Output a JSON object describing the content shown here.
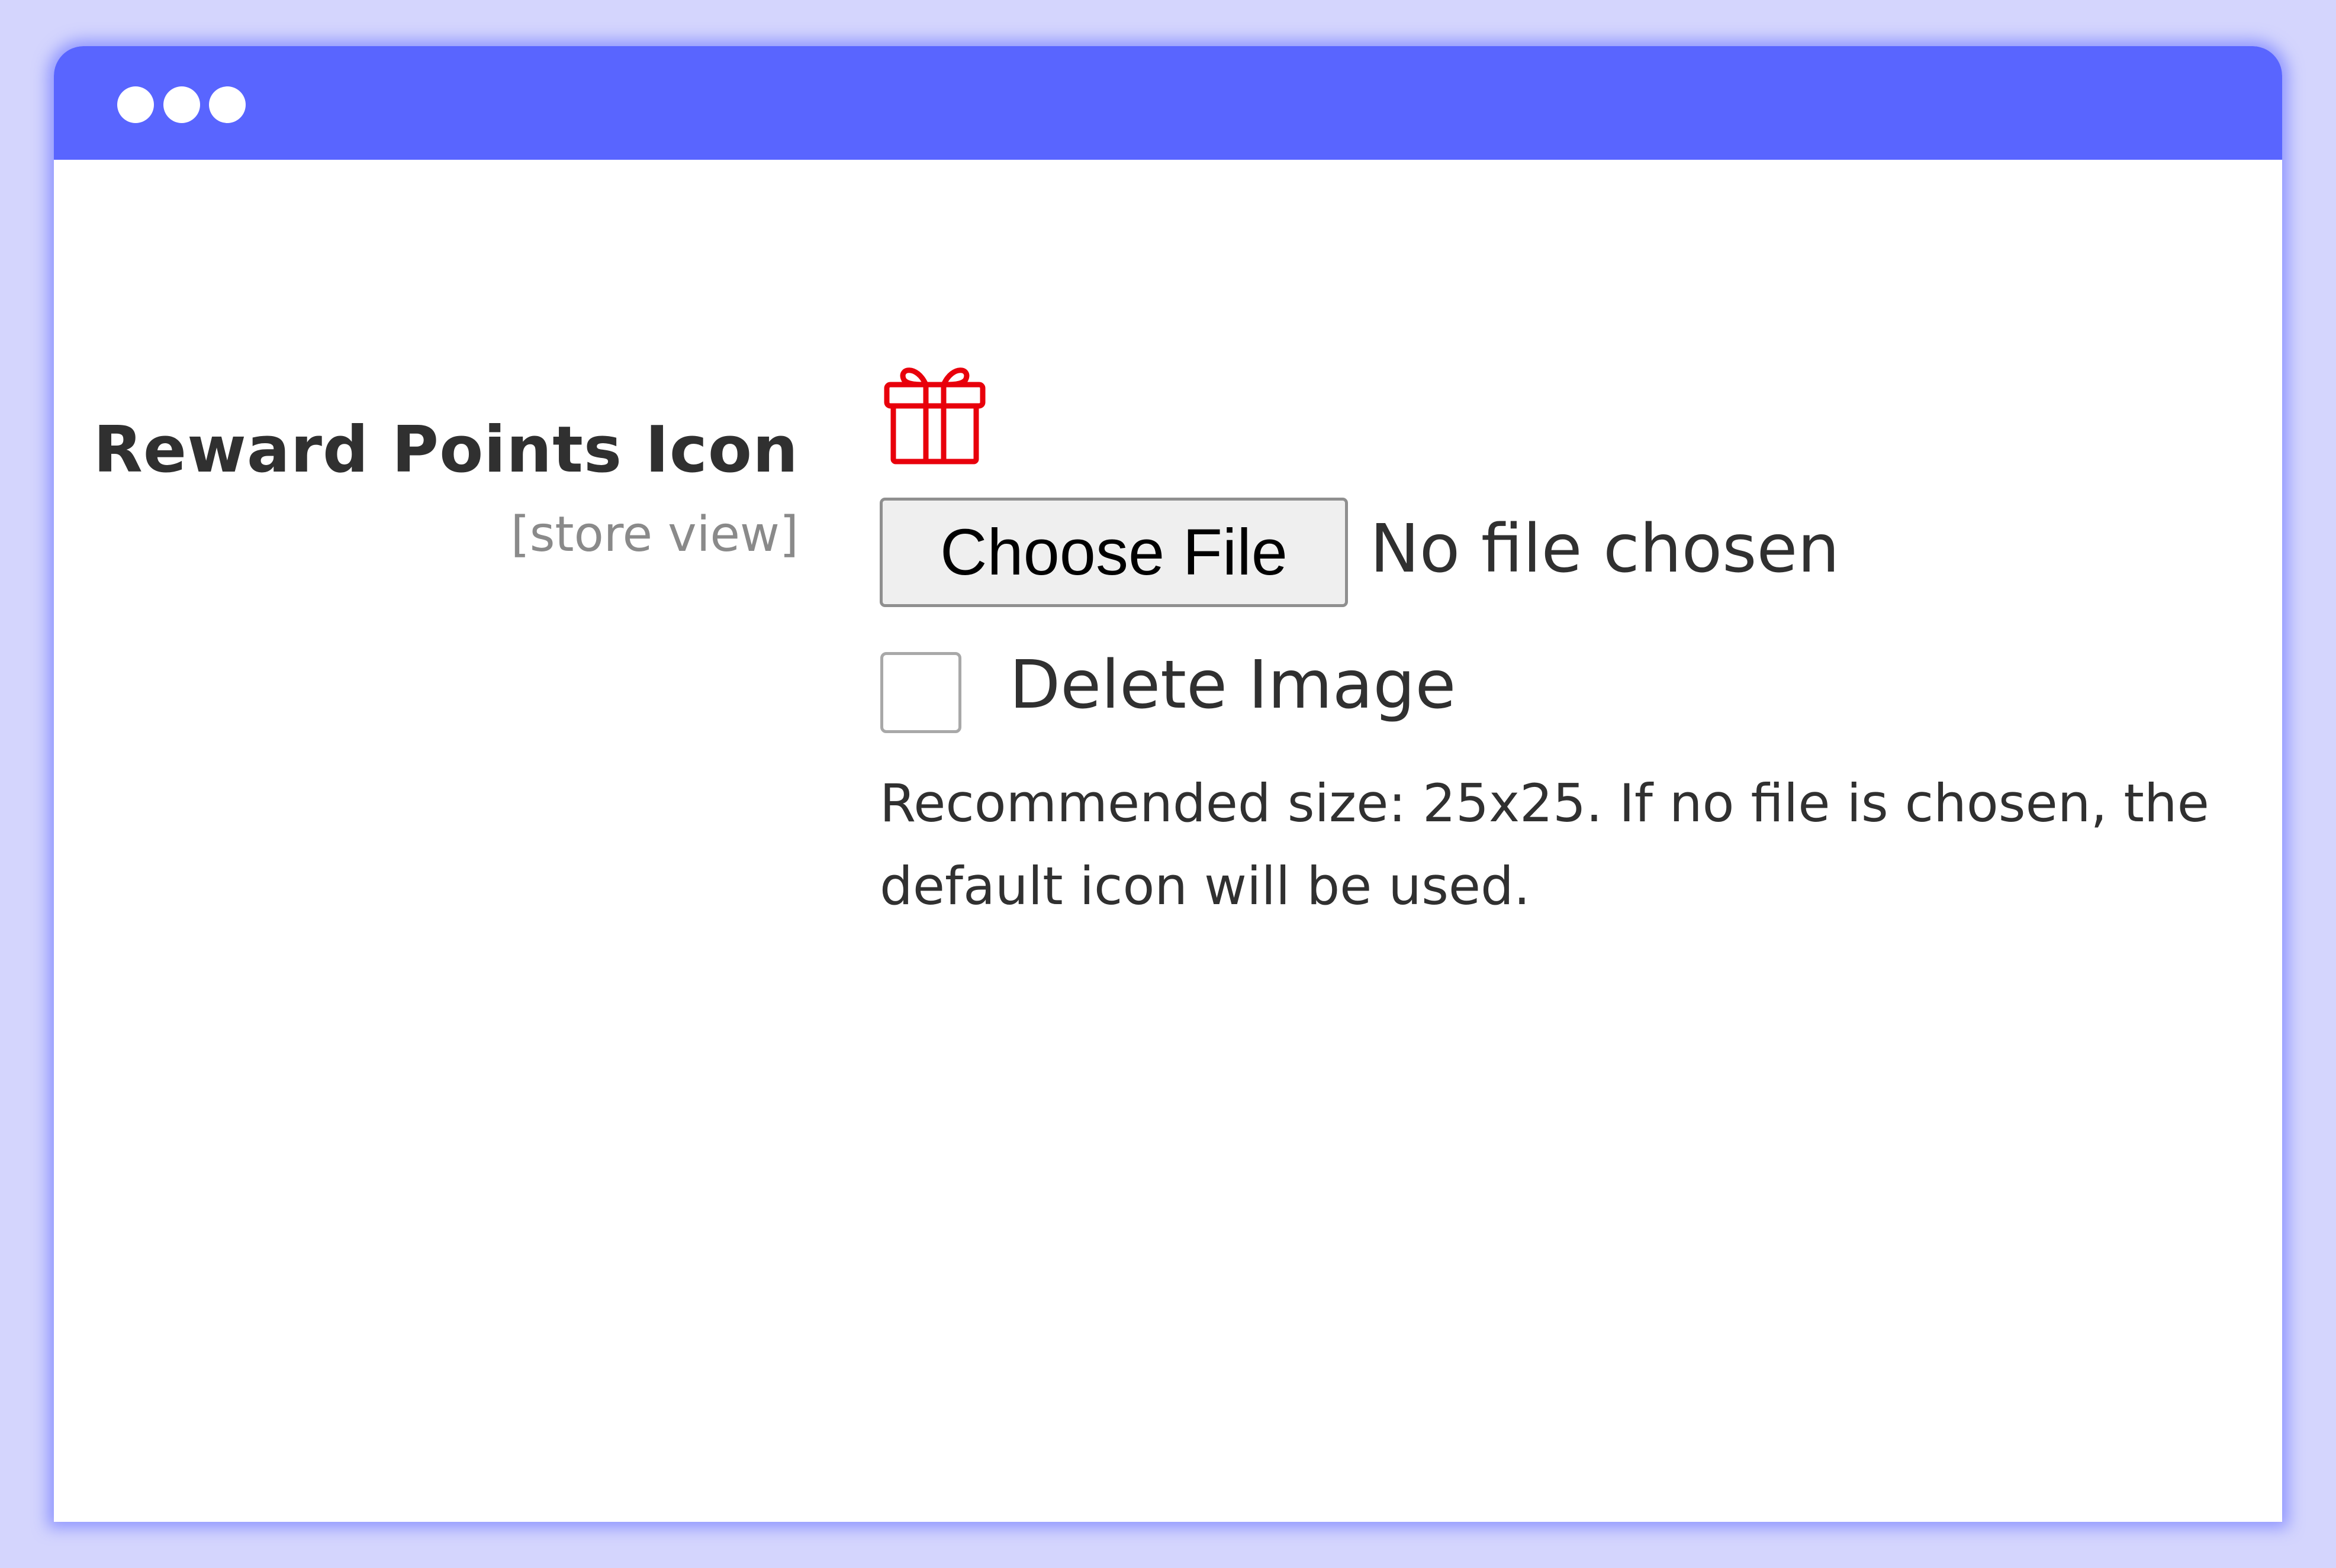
{
  "window": {
    "titlebar_color": "#5965ff",
    "controls": [
      "dot",
      "dot",
      "dot"
    ]
  },
  "field": {
    "label": "Reward Points Icon",
    "scope": "[store view]",
    "current_icon": "gift-icon",
    "icon_color": "#e8000b",
    "file_button_label": "Choose File",
    "file_status": "No file chosen",
    "delete_checkbox_label": "Delete Image",
    "delete_checked": false,
    "note": "Recommended size: 25x25. If no file is chosen, the default icon will be used."
  }
}
